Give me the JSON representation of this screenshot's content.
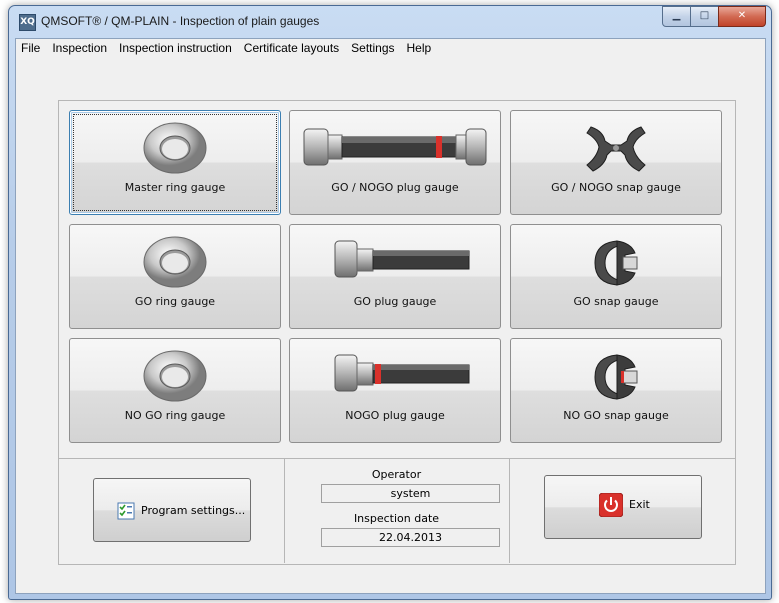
{
  "window": {
    "title": "QMSOFT® / QM-PLAIN - Inspection of plain gauges",
    "app_icon_text": "XQ",
    "min_glyph": "▁",
    "max_glyph": "□",
    "close_glyph": "✕"
  },
  "menu": [
    "File",
    "Inspection",
    "Inspection instruction",
    "Certificate layouts",
    "Settings",
    "Help"
  ],
  "gauges": [
    {
      "label": "Master ring gauge",
      "icon": "ring-icon"
    },
    {
      "label": "GO / NOGO plug gauge",
      "icon": "double-plug-icon"
    },
    {
      "label": "GO / NOGO snap gauge",
      "icon": "snap-double-icon"
    },
    {
      "label": "GO ring gauge",
      "icon": "ring-icon"
    },
    {
      "label": "GO plug gauge",
      "icon": "plug-icon"
    },
    {
      "label": "GO snap gauge",
      "icon": "snap-icon"
    },
    {
      "label": "NO GO ring gauge",
      "icon": "ring-icon"
    },
    {
      "label": "NOGO plug gauge",
      "icon": "plug-red-icon"
    },
    {
      "label": "NO GO snap gauge",
      "icon": "snap-icon"
    }
  ],
  "program_settings": {
    "label": "Program settings...",
    "icon": "checklist-icon"
  },
  "operator": {
    "label": "Operator",
    "value": "system"
  },
  "inspection_date": {
    "label": "Inspection date",
    "value": "22.04.2013"
  },
  "exit": {
    "label": "Exit",
    "icon": "power-icon"
  },
  "colors": {
    "accent_red": "#d9312b",
    "window_frame": "#b7cde9",
    "client_bg": "#f0f0f0"
  }
}
